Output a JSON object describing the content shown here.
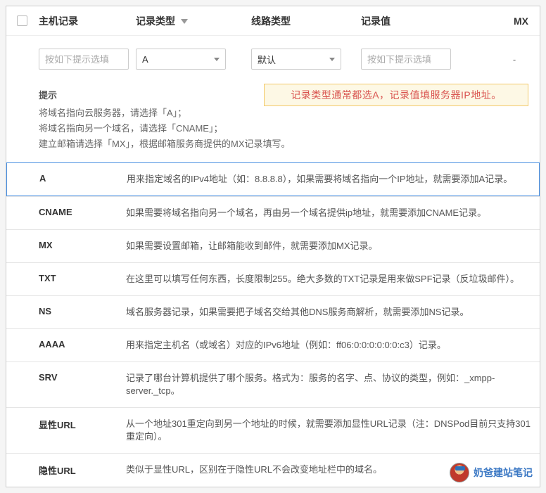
{
  "header": {
    "col1": "主机记录",
    "col2": "记录类型",
    "col3": "线路类型",
    "col4": "记录值",
    "col5": "MX"
  },
  "inputs": {
    "host_placeholder": "按如下提示选填",
    "record_type_value": "A",
    "line_type_value": "默认",
    "record_value_placeholder": "按如下提示选填",
    "mx_value": "-"
  },
  "hint": {
    "title": "提示",
    "line1": "将域名指向云服务器，请选择「A」；",
    "line2": "将域名指向另一个域名，请选择「CNAME」；",
    "line3": "建立邮箱请选择「MX」，根据邮箱服务商提供的MX记录填写。"
  },
  "callout": "记录类型通常都选A，记录值填服务器IP地址。",
  "records": [
    {
      "type": "A",
      "active": true,
      "desc": "用来指定域名的IPv4地址（如：8.8.8.8），如果需要将域名指向一个IP地址，就需要添加A记录。"
    },
    {
      "type": "CNAME",
      "active": false,
      "desc": "如果需要将域名指向另一个域名，再由另一个域名提供ip地址，就需要添加CNAME记录。"
    },
    {
      "type": "MX",
      "active": false,
      "desc": "如果需要设置邮箱，让邮箱能收到邮件，就需要添加MX记录。"
    },
    {
      "type": "TXT",
      "active": false,
      "desc": "在这里可以填写任何东西，长度限制255。绝大多数的TXT记录是用来做SPF记录（反垃圾邮件）。"
    },
    {
      "type": "NS",
      "active": false,
      "desc": "域名服务器记录，如果需要把子域名交给其他DNS服务商解析，就需要添加NS记录。"
    },
    {
      "type": "AAAA",
      "active": false,
      "desc": "用来指定主机名（或域名）对应的IPv6地址（例如：ff06:0:0:0:0:0:0:c3）记录。"
    },
    {
      "type": "SRV",
      "active": false,
      "desc": "记录了哪台计算机提供了哪个服务。格式为：服务的名字、点、协议的类型，例如：_xmpp-server._tcp。"
    },
    {
      "type": "显性URL",
      "active": false,
      "desc": "从一个地址301重定向到另一个地址的时候，就需要添加显性URL记录（注：DNSPod目前只支持301重定向）。"
    },
    {
      "type": "隐性URL",
      "active": false,
      "desc": "类似于显性URL，区别在于隐性URL不会改变地址栏中的域名。"
    }
  ],
  "watermark": "奶爸建站笔记"
}
